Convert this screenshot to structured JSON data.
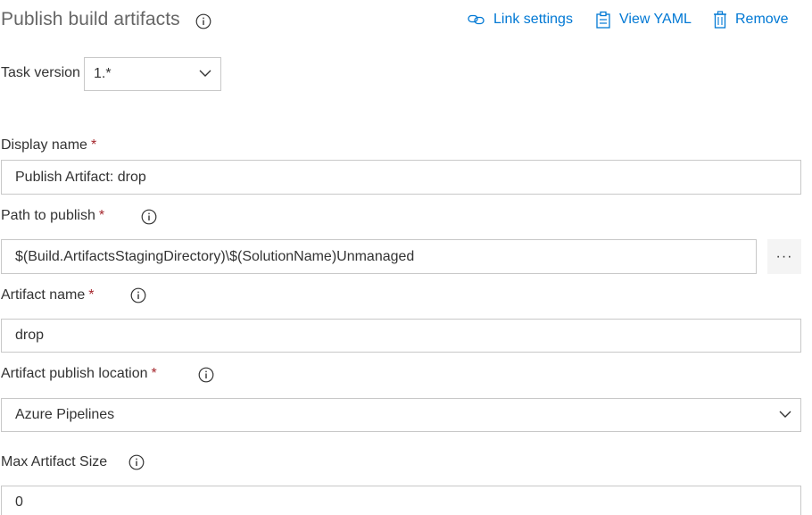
{
  "header": {
    "title": "Publish build artifacts",
    "link_settings": "Link settings",
    "view_yaml": "View YAML",
    "remove": "Remove"
  },
  "task_version": {
    "label": "Task version",
    "value": "1.*"
  },
  "fields": {
    "display_name": {
      "label": "Display name",
      "value": "Publish Artifact: drop"
    },
    "path_to_publish": {
      "label": "Path to publish",
      "value": "$(Build.ArtifactsStagingDirectory)\\$(SolutionName)Unmanaged",
      "browse": "···"
    },
    "artifact_name": {
      "label": "Artifact name",
      "value": "drop"
    },
    "publish_location": {
      "label": "Artifact publish location",
      "value": "Azure Pipelines"
    },
    "max_artifact_size": {
      "label": "Max Artifact Size",
      "value": "0"
    }
  },
  "required_marker": "*",
  "colors": {
    "accent": "#0078d4",
    "required": "#a4262c",
    "border": "#c8c8c8"
  }
}
